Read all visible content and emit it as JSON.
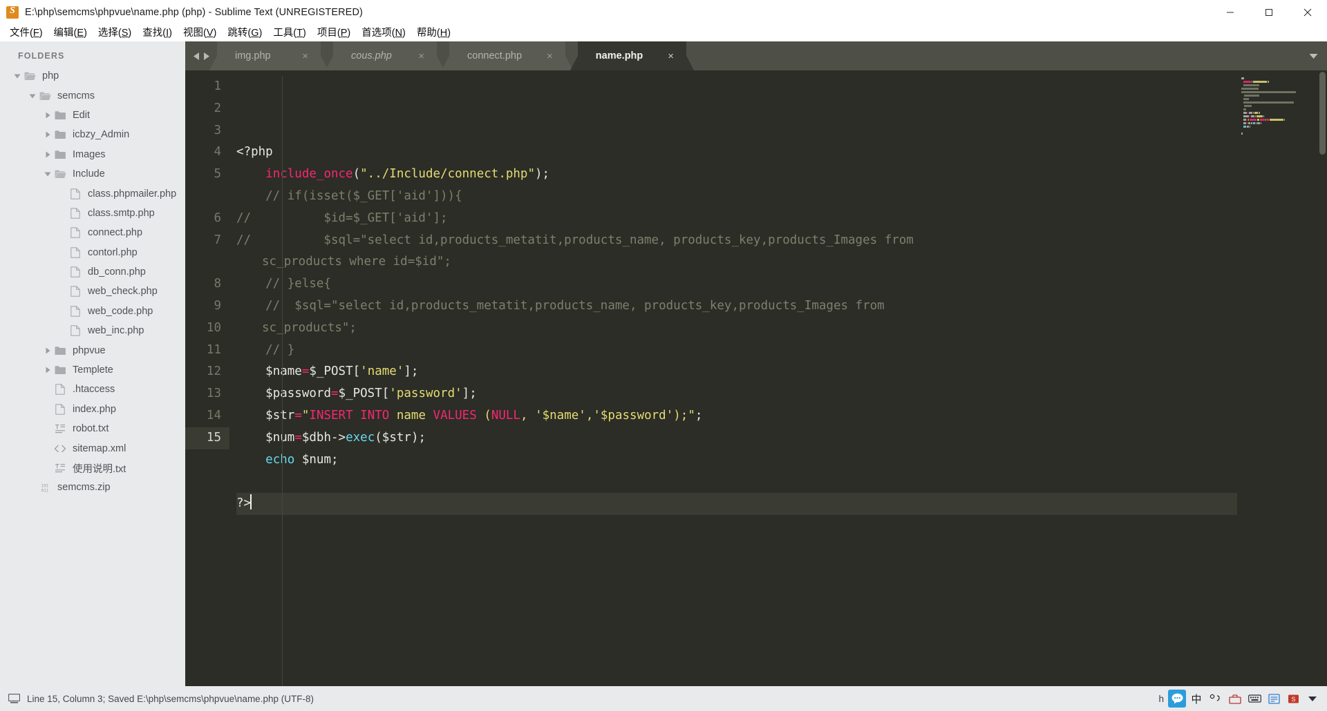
{
  "window": {
    "title": "E:\\php\\semcms\\phpvue\\name.php (php) - Sublime Text (UNREGISTERED)",
    "app_icon": "sublime-text-icon",
    "minimize_label": "–",
    "maximize_label": "❐",
    "close_label": "✕"
  },
  "menubar": {
    "items": [
      {
        "label": "文件(F)",
        "name": "file"
      },
      {
        "label": "编辑(E)",
        "name": "edit"
      },
      {
        "label": "选择(S)",
        "name": "selection"
      },
      {
        "label": "查找(I)",
        "name": "find"
      },
      {
        "label": "视图(V)",
        "name": "view"
      },
      {
        "label": "跳转(G)",
        "name": "goto"
      },
      {
        "label": "工具(T)",
        "name": "tools"
      },
      {
        "label": "项目(P)",
        "name": "project"
      },
      {
        "label": "首选项(N)",
        "name": "preferences"
      },
      {
        "label": "帮助(H)",
        "name": "help"
      }
    ]
  },
  "sidebar": {
    "header": "FOLDERS",
    "tree": [
      {
        "label": "php",
        "depth": 0,
        "type": "folder",
        "open": true,
        "icon": "folder-open-icon"
      },
      {
        "label": "semcms",
        "depth": 1,
        "type": "folder",
        "open": true,
        "icon": "folder-open-icon"
      },
      {
        "label": "Edit",
        "depth": 2,
        "type": "folder",
        "open": false,
        "icon": "folder-icon"
      },
      {
        "label": "icbzy_Admin",
        "depth": 2,
        "type": "folder",
        "open": false,
        "icon": "folder-icon"
      },
      {
        "label": "Images",
        "depth": 2,
        "type": "folder",
        "open": false,
        "icon": "folder-icon"
      },
      {
        "label": "Include",
        "depth": 2,
        "type": "folder",
        "open": true,
        "icon": "folder-open-icon"
      },
      {
        "label": "class.phpmailer.php",
        "depth": 3,
        "type": "file",
        "icon": "file-icon"
      },
      {
        "label": "class.smtp.php",
        "depth": 3,
        "type": "file",
        "icon": "file-icon"
      },
      {
        "label": "connect.php",
        "depth": 3,
        "type": "file",
        "icon": "file-icon"
      },
      {
        "label": "contorl.php",
        "depth": 3,
        "type": "file",
        "icon": "file-icon"
      },
      {
        "label": "db_conn.php",
        "depth": 3,
        "type": "file",
        "icon": "file-icon"
      },
      {
        "label": "web_check.php",
        "depth": 3,
        "type": "file",
        "icon": "file-icon"
      },
      {
        "label": "web_code.php",
        "depth": 3,
        "type": "file",
        "icon": "file-icon"
      },
      {
        "label": "web_inc.php",
        "depth": 3,
        "type": "file",
        "icon": "file-icon"
      },
      {
        "label": "phpvue",
        "depth": 2,
        "type": "folder",
        "open": false,
        "icon": "folder-icon"
      },
      {
        "label": "Templete",
        "depth": 2,
        "type": "folder",
        "open": false,
        "icon": "folder-icon"
      },
      {
        "label": ".htaccess",
        "depth": 2,
        "type": "file",
        "icon": "file-icon"
      },
      {
        "label": "index.php",
        "depth": 2,
        "type": "file",
        "icon": "file-icon"
      },
      {
        "label": "robot.txt",
        "depth": 2,
        "type": "file",
        "icon": "text-file-icon"
      },
      {
        "label": "sitemap.xml",
        "depth": 2,
        "type": "file",
        "icon": "code-file-icon"
      },
      {
        "label": "使用说明.txt",
        "depth": 2,
        "type": "file",
        "icon": "text-file-icon"
      },
      {
        "label": "semcms.zip",
        "depth": 1,
        "type": "file",
        "icon": "binary-file-icon"
      }
    ]
  },
  "tabbar": {
    "nav_prev_icon": "arrow-left-icon",
    "nav_next_icon": "arrow-right-icon",
    "menu_icon": "chevron-down-icon",
    "close_label": "×",
    "tabs": [
      {
        "label": "img.php",
        "active": false,
        "preview": false
      },
      {
        "label": "cous.php",
        "active": false,
        "preview": true
      },
      {
        "label": "connect.php",
        "active": false,
        "preview": false
      },
      {
        "label": "name.php",
        "active": true,
        "preview": false
      }
    ]
  },
  "editor": {
    "language": "php",
    "cursor_line": 15,
    "lines": [
      {
        "no": 1,
        "tokens": [
          {
            "t": "<?php",
            "c": "c-def"
          }
        ]
      },
      {
        "no": 2,
        "tokens": [
          {
            "t": "    ",
            "c": "c-def"
          },
          {
            "t": "include_once",
            "c": "c-fn"
          },
          {
            "t": "(",
            "c": "c-pun"
          },
          {
            "t": "\"../Include/connect.php\"",
            "c": "c-str"
          },
          {
            "t": ");",
            "c": "c-pun"
          }
        ]
      },
      {
        "no": 3,
        "tokens": [
          {
            "t": "    // if(isset($_GET['aid'])){",
            "c": "c-com"
          }
        ]
      },
      {
        "no": 4,
        "tokens": [
          {
            "t": "//          $id=$_GET['aid'];",
            "c": "c-com"
          }
        ]
      },
      {
        "no": 5,
        "tokens": [
          {
            "t": "//          $sql=\"select id,products_metatit,products_name, products_key,products_Images from",
            "c": "c-com"
          }
        ],
        "wrap": {
          "t": "sc_products where id=$id\";",
          "c": "c-com"
        }
      },
      {
        "no": 6,
        "tokens": [
          {
            "t": "    // }else{",
            "c": "c-com"
          }
        ]
      },
      {
        "no": 7,
        "tokens": [
          {
            "t": "    //  $sql=\"select id,products_metatit,products_name, products_key,products_Images from",
            "c": "c-com"
          }
        ],
        "wrap": {
          "t": "sc_products\";",
          "c": "c-com"
        }
      },
      {
        "no": 8,
        "tokens": [
          {
            "t": "    // }",
            "c": "c-com"
          }
        ]
      },
      {
        "no": 9,
        "tokens": [
          {
            "t": "    ",
            "c": "c-def"
          },
          {
            "t": "$name",
            "c": "c-var"
          },
          {
            "t": "=",
            "c": "c-op"
          },
          {
            "t": "$_POST",
            "c": "c-var"
          },
          {
            "t": "[",
            "c": "c-pun"
          },
          {
            "t": "'name'",
            "c": "c-str"
          },
          {
            "t": "];",
            "c": "c-pun"
          }
        ]
      },
      {
        "no": 10,
        "tokens": [
          {
            "t": "    ",
            "c": "c-def"
          },
          {
            "t": "$password",
            "c": "c-var"
          },
          {
            "t": "=",
            "c": "c-op"
          },
          {
            "t": "$_POST",
            "c": "c-var"
          },
          {
            "t": "[",
            "c": "c-pun"
          },
          {
            "t": "'password'",
            "c": "c-str"
          },
          {
            "t": "];",
            "c": "c-pun"
          }
        ]
      },
      {
        "no": 11,
        "tokens": [
          {
            "t": "    ",
            "c": "c-def"
          },
          {
            "t": "$str",
            "c": "c-var"
          },
          {
            "t": "=",
            "c": "c-op"
          },
          {
            "t": "\"",
            "c": "c-str"
          },
          {
            "t": "INSERT INTO ",
            "c": "c-kw"
          },
          {
            "t": "name",
            "c": "c-str"
          },
          {
            "t": " VALUES ",
            "c": "c-kw"
          },
          {
            "t": "(",
            "c": "c-str"
          },
          {
            "t": "NULL",
            "c": "c-kw"
          },
          {
            "t": ", '$name','$password');\"",
            "c": "c-str"
          },
          {
            "t": ";",
            "c": "c-pun"
          }
        ]
      },
      {
        "no": 12,
        "tokens": [
          {
            "t": "    ",
            "c": "c-def"
          },
          {
            "t": "$num",
            "c": "c-var"
          },
          {
            "t": "=",
            "c": "c-op"
          },
          {
            "t": "$dbh",
            "c": "c-var"
          },
          {
            "t": "->",
            "c": "c-pun"
          },
          {
            "t": "exec",
            "c": "c-cy"
          },
          {
            "t": "(",
            "c": "c-pun"
          },
          {
            "t": "$str",
            "c": "c-var"
          },
          {
            "t": ");",
            "c": "c-pun"
          }
        ]
      },
      {
        "no": 13,
        "tokens": [
          {
            "t": "    ",
            "c": "c-def"
          },
          {
            "t": "echo",
            "c": "c-cy"
          },
          {
            "t": " ",
            "c": "c-def"
          },
          {
            "t": "$num",
            "c": "c-var"
          },
          {
            "t": ";",
            "c": "c-pun"
          }
        ]
      },
      {
        "no": 14,
        "tokens": []
      },
      {
        "no": 15,
        "tokens": [
          {
            "t": "?>",
            "c": "c-def"
          }
        ],
        "cursor": true
      }
    ],
    "colors": {
      "background": "#2b2d26",
      "foreground": "#e8e8e3",
      "comment": "#7d806d",
      "string": "#e6db74",
      "keyword": "#f92672",
      "function": "#66d9ef",
      "line_highlight": "#3a3c33",
      "gutter_text": "#767a6a"
    }
  },
  "statusbar": {
    "icon": "computer-icon",
    "text": "Line 15, Column 3; Saved E:\\php\\semcms\\phpvue\\name.php (UTF-8)",
    "tray": {
      "hint_text": "h",
      "items": [
        {
          "name": "ime-chat-icon",
          "glyph": "●",
          "style": "blue"
        },
        {
          "name": "ime-chinese-mode",
          "glyph": "中",
          "style": "cn"
        },
        {
          "name": "ime-punctuation-icon",
          "glyph": "°,",
          "style": "cn"
        },
        {
          "name": "ime-toolbox-icon",
          "glyph": "⚒",
          "style": "cn"
        },
        {
          "name": "ime-keyboard-icon",
          "glyph": "⌨",
          "style": "cn"
        },
        {
          "name": "ime-notes-icon",
          "glyph": "▤",
          "style": "cn"
        },
        {
          "name": "ime-settings-icon",
          "glyph": "▣",
          "style": "cn"
        },
        {
          "name": "ime-menu-icon",
          "glyph": "▼",
          "style": "cn"
        }
      ]
    }
  }
}
